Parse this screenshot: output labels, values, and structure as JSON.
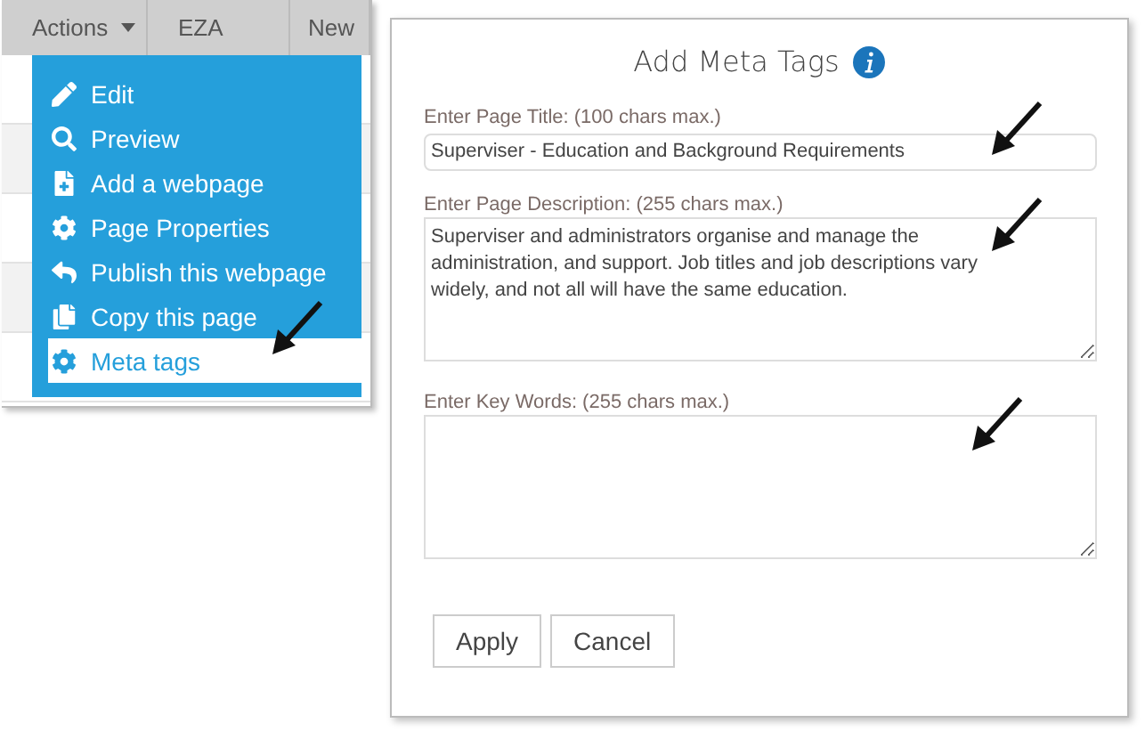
{
  "table": {
    "columns": [
      "Actions",
      "EZA",
      "New"
    ]
  },
  "menu": {
    "items": [
      {
        "label": "Edit",
        "selected": false
      },
      {
        "label": "Preview",
        "selected": false
      },
      {
        "label": "Add a webpage",
        "selected": false
      },
      {
        "label": "Page Properties",
        "selected": false
      },
      {
        "label": "Publish this webpage",
        "selected": false
      },
      {
        "label": "Copy this page",
        "selected": false
      },
      {
        "label": "Meta tags",
        "selected": true
      }
    ]
  },
  "dialog": {
    "title": "Add Meta Tags",
    "fields": [
      {
        "kind": "input",
        "label": "Enter Page Title: (100 chars max.)",
        "value": "Superviser - Education and Background Requirements"
      },
      {
        "kind": "textarea",
        "label": "Enter Page Description: (255 chars max.)",
        "value": "Superviser and administrators organise and manage the administration, and support. Job titles and job descriptions vary widely, and not all will have the same education."
      },
      {
        "kind": "textarea",
        "label": "Enter Key Words: (255 chars max.)"
      }
    ],
    "buttons": [
      "Apply",
      "Cancel"
    ]
  }
}
